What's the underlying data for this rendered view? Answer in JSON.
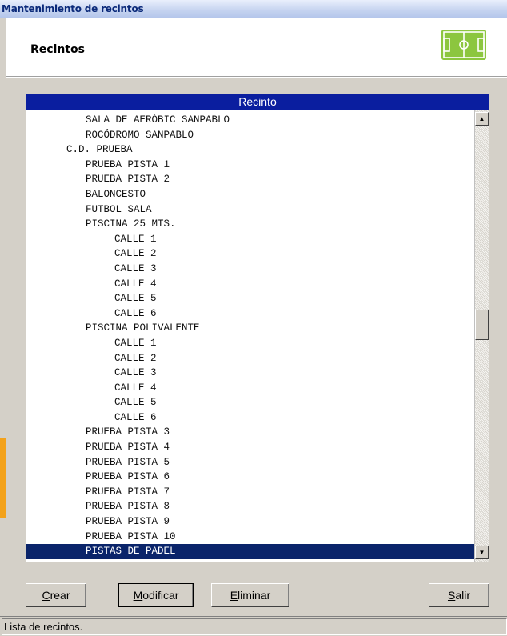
{
  "window": {
    "title": "Mantenimiento de recintos"
  },
  "header": {
    "title": "Recintos",
    "logo_icon": "football-field-icon",
    "logo_color": "#8cc63f"
  },
  "list": {
    "column_header": "Recinto",
    "rows": [
      {
        "indent": 2,
        "label": "SALA DE AERÓBIC SANPABLO"
      },
      {
        "indent": 2,
        "label": "ROCÓDROMO SANPABLO"
      },
      {
        "indent": 1,
        "label": "C.D. PRUEBA"
      },
      {
        "indent": 2,
        "label": "PRUEBA PISTA 1"
      },
      {
        "indent": 2,
        "label": "PRUEBA PISTA 2"
      },
      {
        "indent": 2,
        "label": "BALONCESTO"
      },
      {
        "indent": 2,
        "label": "FUTBOL SALA"
      },
      {
        "indent": 2,
        "label": "PISCINA 25 MTS."
      },
      {
        "indent": 3,
        "label": "CALLE 1"
      },
      {
        "indent": 3,
        "label": "CALLE 2"
      },
      {
        "indent": 3,
        "label": "CALLE 3"
      },
      {
        "indent": 3,
        "label": "CALLE 4"
      },
      {
        "indent": 3,
        "label": "CALLE 5"
      },
      {
        "indent": 3,
        "label": "CALLE 6"
      },
      {
        "indent": 2,
        "label": "PISCINA POLIVALENTE"
      },
      {
        "indent": 3,
        "label": "CALLE 1"
      },
      {
        "indent": 3,
        "label": "CALLE 2"
      },
      {
        "indent": 3,
        "label": "CALLE 3"
      },
      {
        "indent": 3,
        "label": "CALLE 4"
      },
      {
        "indent": 3,
        "label": "CALLE 5"
      },
      {
        "indent": 3,
        "label": "CALLE 6"
      },
      {
        "indent": 2,
        "label": "PRUEBA PISTA 3"
      },
      {
        "indent": 2,
        "label": "PRUEBA PISTA 4"
      },
      {
        "indent": 2,
        "label": "PRUEBA PISTA 5"
      },
      {
        "indent": 2,
        "label": "PRUEBA PISTA 6"
      },
      {
        "indent": 2,
        "label": "PRUEBA PISTA 7"
      },
      {
        "indent": 2,
        "label": "PRUEBA PISTA 8"
      },
      {
        "indent": 2,
        "label": "PRUEBA PISTA 9"
      },
      {
        "indent": 2,
        "label": "PRUEBA PISTA 10"
      },
      {
        "indent": 2,
        "label": "PISTAS DE PADEL",
        "selected": true
      }
    ],
    "scroll_position": 0.47,
    "selection_color": "#0a246a",
    "header_color": "#0a1e9f"
  },
  "buttons": {
    "crear": {
      "mnemonic": "C",
      "rest": "rear"
    },
    "modificar": {
      "mnemonic": "M",
      "rest": "odificar"
    },
    "eliminar": {
      "mnemonic": "E",
      "rest": "liminar"
    },
    "salir": {
      "mnemonic": "S",
      "rest": "alir"
    }
  },
  "status": {
    "text": "Lista de recintos."
  },
  "colors": {
    "accent": "#f3a21b",
    "background": "#d4d0c8"
  }
}
